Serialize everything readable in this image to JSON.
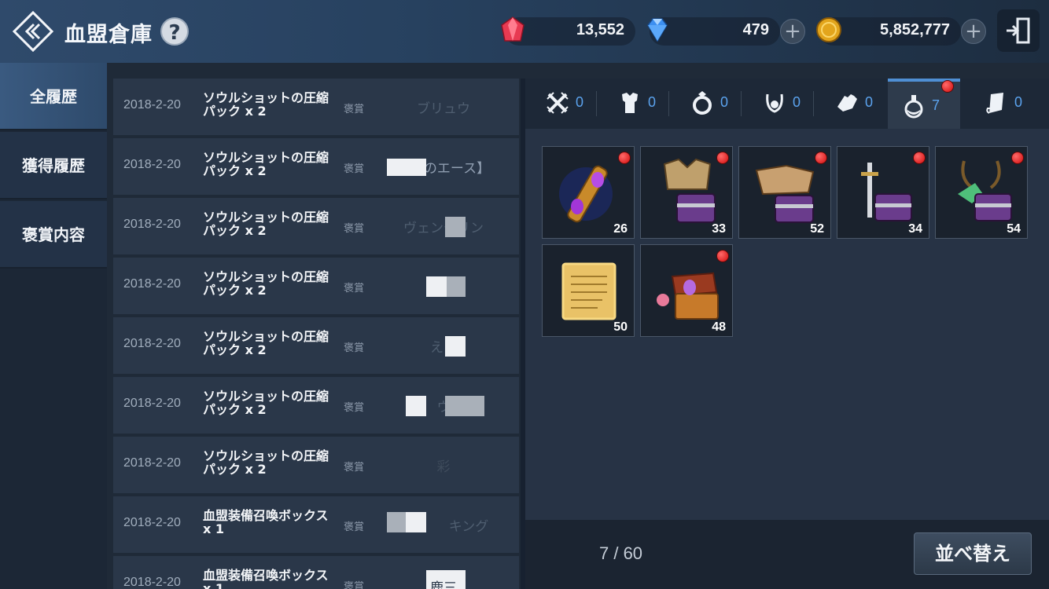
{
  "header": {
    "title": "血盟倉庫",
    "help_label": "?",
    "currencies": [
      {
        "icon": "red-gem-icon",
        "value": "13,552"
      },
      {
        "icon": "blue-diamond-icon",
        "value": "479"
      },
      {
        "icon": "gold-coin-icon",
        "value": "5,852,777"
      }
    ],
    "plus_label": "+"
  },
  "nav": {
    "items": [
      {
        "label": "全履歴",
        "active": true
      },
      {
        "label": "獲得履歴",
        "active": false
      },
      {
        "label": "褒賞内容",
        "active": false
      }
    ]
  },
  "history": {
    "rows": [
      {
        "date": "2018-2-20",
        "item": "ソウルショットの圧縮パック x 2",
        "type": "褒賞",
        "name": "ブリュウ"
      },
      {
        "date": "2018-2-20",
        "item": "ソウルショットの圧縮パック x 2",
        "type": "褒賞",
        "name": "【火のエース】"
      },
      {
        "date": "2018-2-20",
        "item": "ソウルショットの圧縮パック x 2",
        "type": "褒賞",
        "name": "ヴェンデリン"
      },
      {
        "date": "2018-2-20",
        "item": "ソウルショットの圧縮パック x 2",
        "type": "褒賞",
        "name": "☆"
      },
      {
        "date": "2018-2-20",
        "item": "ソウルショットの圧縮パック x 2",
        "type": "褒賞",
        "name": "えり"
      },
      {
        "date": "2018-2-20",
        "item": "ソウルショットの圧縮パック x 2",
        "type": "褒賞",
        "name": "ウ"
      },
      {
        "date": "2018-2-20",
        "item": "ソウルショットの圧縮パック x 2",
        "type": "褒賞",
        "name": "彩"
      },
      {
        "date": "2018-2-20",
        "item": "血盟装備召喚ボックス x 1",
        "type": "褒賞",
        "name": "キング"
      },
      {
        "date": "2018-2-20",
        "item": "血盟装備召喚ボックス x 1",
        "type": "褒賞",
        "name": "鹿三"
      }
    ]
  },
  "tabs": [
    {
      "icon": "crossed-swords-icon",
      "count": "0",
      "active": false,
      "badge": false
    },
    {
      "icon": "armor-icon",
      "count": "0",
      "active": false,
      "badge": false
    },
    {
      "icon": "ring-icon",
      "count": "0",
      "active": false,
      "badge": false
    },
    {
      "icon": "amulet-icon",
      "count": "0",
      "active": false,
      "badge": false
    },
    {
      "icon": "gloves-icon",
      "count": "0",
      "active": false,
      "badge": false
    },
    {
      "icon": "potion-icon",
      "count": "7",
      "active": true,
      "badge": true
    },
    {
      "icon": "scroll-icon",
      "count": "0",
      "active": false,
      "badge": false
    }
  ],
  "inventory": {
    "items": [
      {
        "icon": "soulshot-pack-icon",
        "count": "26",
        "badge": true
      },
      {
        "icon": "armor-chest-icon",
        "count": "33",
        "badge": true
      },
      {
        "icon": "weapon-chest-icon",
        "count": "52",
        "badge": true
      },
      {
        "icon": "sword-chest-icon",
        "count": "34",
        "badge": true
      },
      {
        "icon": "horn-chest-icon",
        "count": "54",
        "badge": true
      },
      {
        "icon": "parchment-icon",
        "count": "50",
        "badge": false
      },
      {
        "icon": "treasure-chest-icon",
        "count": "48",
        "badge": true
      }
    ],
    "capacity": "7 / 60"
  },
  "footer": {
    "sort_label": "並べ替え"
  },
  "colors": {
    "accent": "#4f8fd4",
    "tab_count": "#5ba3ee",
    "badge": "#d10b0b"
  }
}
